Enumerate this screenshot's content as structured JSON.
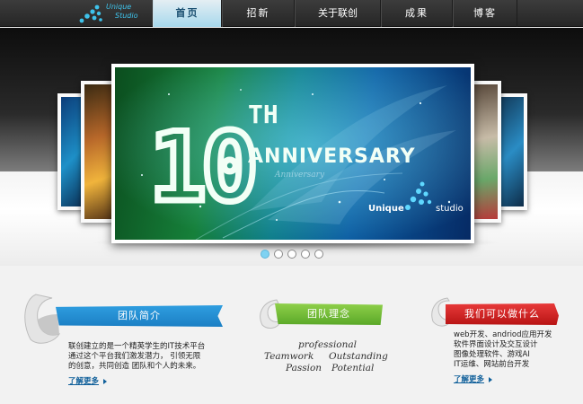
{
  "logo": {
    "line1": "Unique",
    "line2": "Studio"
  },
  "nav": [
    {
      "label": "首页",
      "active": true
    },
    {
      "label": "招新"
    },
    {
      "label": "关于联创"
    },
    {
      "label": "成果"
    },
    {
      "label": "博客"
    }
  ],
  "slider": {
    "slide_text": {
      "number": "10",
      "suffix": "TH",
      "word": "ANNIVERSARY",
      "subtitle": "Anniversary",
      "brand_left": "Unique",
      "brand_right": "studio"
    },
    "dots": 5,
    "active_dot": 1
  },
  "features": {
    "intro": {
      "title": "团队简介",
      "text": "联创建立的是一个精英学生的IT技术平台\n通过这个平台我们激发潜力， 引领无限\n的创意，共同创造 团队和个人的未来。",
      "more": "了解更多"
    },
    "concept": {
      "title": "团队理念",
      "words": [
        "professional",
        "Teamwork",
        "Outstanding",
        "Passion",
        "Potential"
      ]
    },
    "services": {
      "title": "我们可以做什么",
      "text": "web开发、andriod应用开发\n软件界面设计及交互设计\n图像处理软件、游戏AI\nIT运维、网站前台开发",
      "more": "了解更多"
    }
  },
  "colors": {
    "accent": "#3ec2ea",
    "intro_banner": "#1b7fc4",
    "concept_banner": "#5aa828",
    "services_banner": "#c41818",
    "link": "#0f5f9a"
  }
}
